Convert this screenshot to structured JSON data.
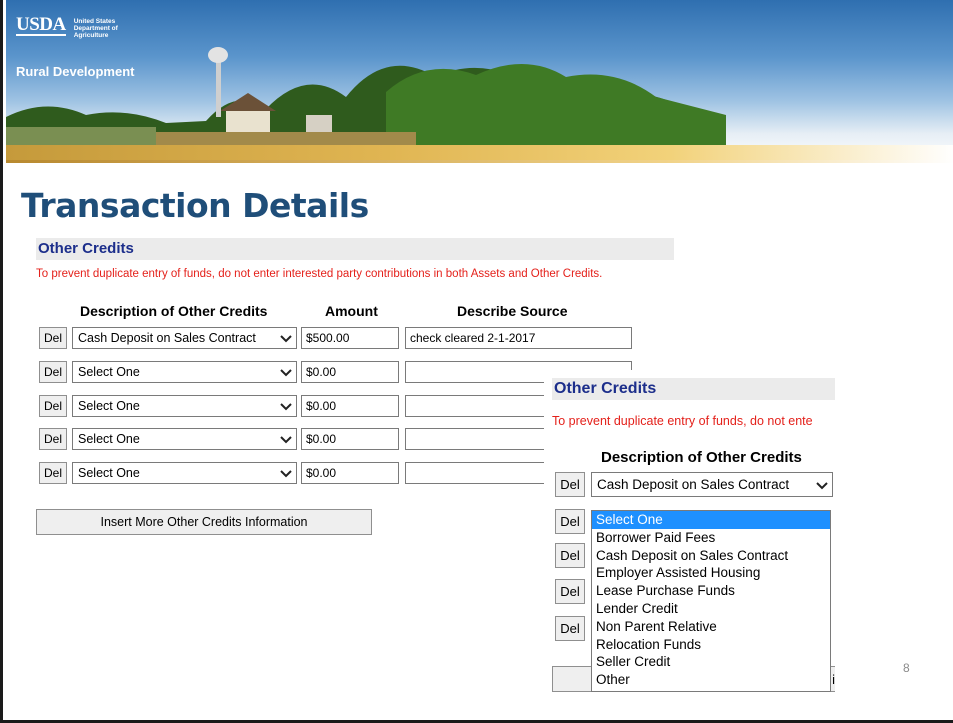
{
  "banner": {
    "usda": "USDA",
    "dept_line1": "United States",
    "dept_line2": "Department of",
    "dept_line3": "Agriculture",
    "agency": "Rural Development"
  },
  "slide": {
    "title": "Transaction Details",
    "page_number": "8"
  },
  "form": {
    "section_title": "Other Credits",
    "warning": "To prevent duplicate entry of funds, do not enter interested party contributions in both Assets and Other Credits.",
    "columns": {
      "description": "Description of Other Credits",
      "amount": "Amount",
      "source": "Describe Source"
    },
    "rows": [
      {
        "del": "Del",
        "description": "Cash Deposit on Sales Contract",
        "amount": "$500.00",
        "source": "check cleared 2-1-2017"
      },
      {
        "del": "Del",
        "description": "Select One",
        "amount": "$0.00",
        "source": ""
      },
      {
        "del": "Del",
        "description": "Select One",
        "amount": "$0.00",
        "source": ""
      },
      {
        "del": "Del",
        "description": "Select One",
        "amount": "$0.00",
        "source": ""
      },
      {
        "del": "Del",
        "description": "Select One",
        "amount": "$0.00",
        "source": ""
      }
    ],
    "insert_button": "Insert More Other Credits Information"
  },
  "zoom": {
    "section_title": "Other Credits",
    "warning": "To prevent duplicate entry of funds, do not ente",
    "column": "Description of Other Credits",
    "del": "Del",
    "first_select": "Cash Deposit on Sales Contract",
    "dropdown_options": [
      "Select One",
      "Borrower Paid Fees",
      "Cash Deposit on Sales Contract",
      "Employer Assisted Housing",
      "Lease Purchase Funds",
      "Lender Credit",
      "Non Parent Relative",
      "Relocation Funds",
      "Seller Credit",
      "Other"
    ],
    "dropdown_selected": "Select One",
    "insert_button_fragment": "i"
  },
  "colors": {
    "title": "#1f4e79",
    "section_text": "#1c2e8b",
    "warning": "#e4211b",
    "dropdown_highlight": "#1e90ff"
  }
}
